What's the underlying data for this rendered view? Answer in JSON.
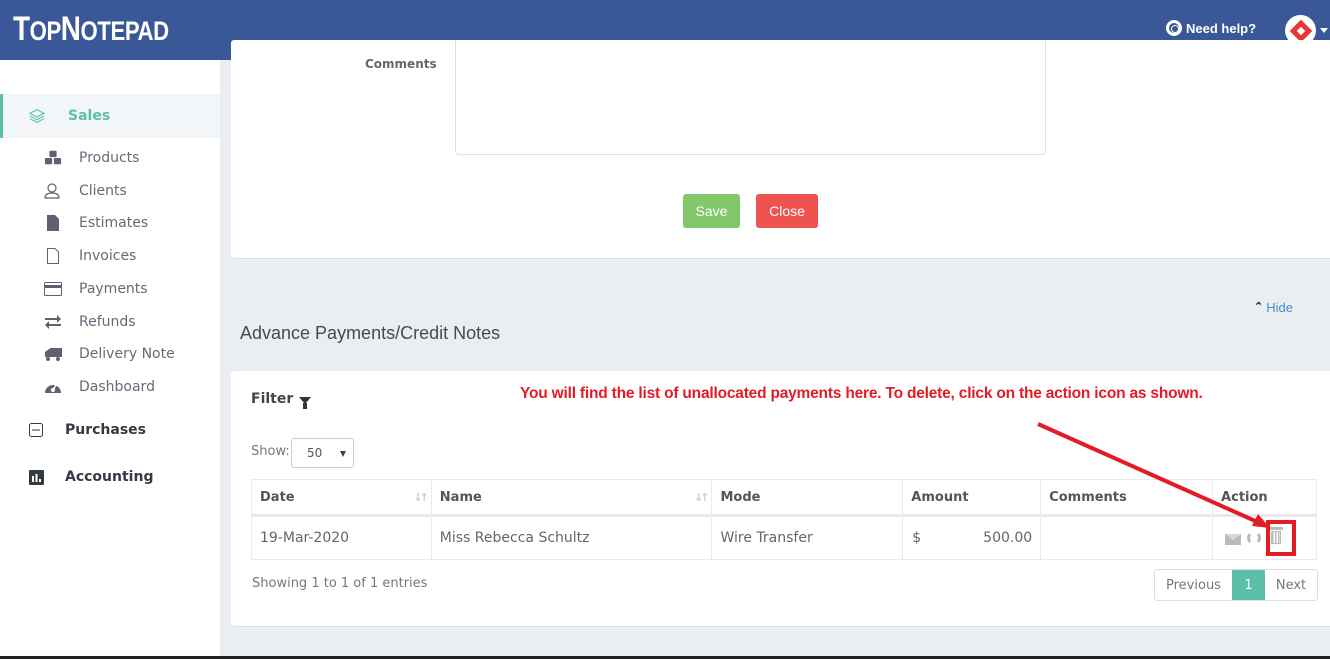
{
  "header": {
    "logo_big_1": "T",
    "logo_small_1": "OP",
    "logo_big_2": "N",
    "logo_small_2": "OTEPAD",
    "help_label": "Need help?"
  },
  "sidebar": {
    "sales": {
      "label": "Sales",
      "icon": "layers-icon"
    },
    "items": [
      {
        "label": "Products",
        "icon": "cubes-icon"
      },
      {
        "label": "Clients",
        "icon": "users-icon"
      },
      {
        "label": "Estimates",
        "icon": "file-icon"
      },
      {
        "label": "Invoices",
        "icon": "file-outline-icon"
      },
      {
        "label": "Payments",
        "icon": "credit-card-icon"
      },
      {
        "label": "Refunds",
        "icon": "exchange-icon"
      },
      {
        "label": "Delivery Note",
        "icon": "truck-icon"
      },
      {
        "label": "Dashboard",
        "icon": "dashboard-icon"
      }
    ],
    "purchases": {
      "label": "Purchases",
      "icon": "minus-square-icon"
    },
    "accounting": {
      "label": "Accounting",
      "icon": "bar-chart-icon"
    }
  },
  "form": {
    "comments_label": "Comments",
    "comments_value": "",
    "save_label": "Save",
    "close_label": "Close"
  },
  "section": {
    "hide_label": "Hide",
    "title": "Advance Payments/Credit Notes",
    "filter_label": "Filter",
    "annotation": "You will find the list of unallocated payments here. To delete, click on the action icon as shown.",
    "show_label": "Show:",
    "show_value": "50"
  },
  "table": {
    "columns": [
      "Date",
      "Name",
      "Mode",
      "Amount",
      "Comments",
      "Action"
    ],
    "rows": [
      {
        "date": "19-Mar-2020",
        "name": "Miss Rebecca Schultz",
        "mode": "Wire Transfer",
        "currency": "$",
        "amount": "500.00",
        "comments": ""
      }
    ]
  },
  "footer": {
    "showing": "Showing 1 to 1 of 1 entries",
    "prev_label": "Previous",
    "page": "1",
    "next_label": "Next"
  },
  "colors": {
    "header_bg": "#3a5897",
    "accent": "#5cbfa8",
    "save": "#82c769",
    "close": "#ef5350",
    "annotation": "#e31b23"
  }
}
